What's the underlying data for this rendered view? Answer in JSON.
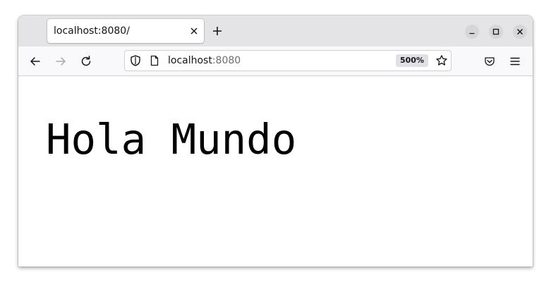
{
  "tab": {
    "title": "localhost:8080/"
  },
  "urlbar": {
    "host": "localhost",
    "port": ":8080",
    "zoom": "500%"
  },
  "page": {
    "heading": "Hola Mundo"
  },
  "icons": {
    "tab_close": "close-icon",
    "new_tab": "plus-icon",
    "minimize": "minimize-icon",
    "maximize": "maximize-icon",
    "close_window": "close-icon",
    "back": "arrow-left-icon",
    "forward": "arrow-right-icon",
    "reload": "reload-icon",
    "tracking": "shield-icon",
    "page_info": "document-icon",
    "bookmark": "star-icon",
    "pocket": "pocket-icon",
    "menu": "hamburger-menu-icon"
  },
  "colors": {
    "tabbar_bg": "#e4e4e7",
    "navbar_bg": "#f9f9fb",
    "text": "#15141a",
    "port_text": "#6d6d70"
  }
}
